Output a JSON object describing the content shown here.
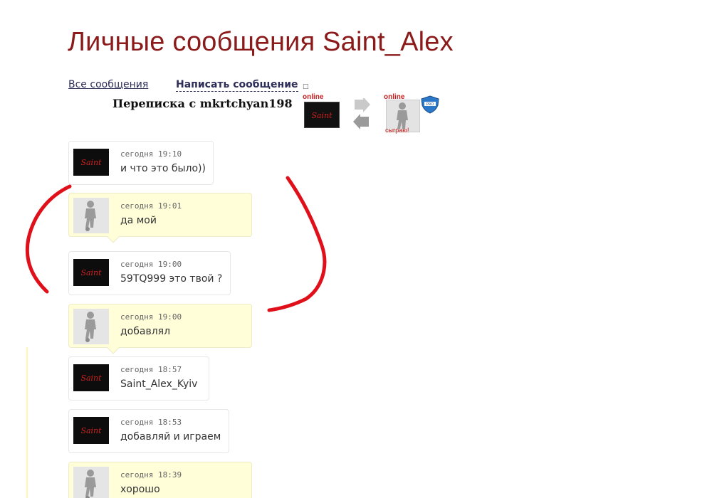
{
  "page": {
    "title": "Личные сообщения Saint_Alex"
  },
  "nav": {
    "all_messages": "Все сообщения",
    "write_message": "Написать сообщение"
  },
  "conversation": {
    "title": "Переписка с mkrtchyan198",
    "online_label_me": "online",
    "online_label_partner": "online",
    "partner_status": "сыграю!",
    "saint_logo_text": "Saint",
    "badge_text": "PRO"
  },
  "messages": [
    {
      "sender": "saint",
      "time": "сегодня 19:10",
      "text": "и что это было))"
    },
    {
      "sender": "other",
      "time": "сегодня 19:01",
      "text": "да мой"
    },
    {
      "sender": "saint",
      "time": "сегодня 19:00",
      "text": "59TQ999 это твой ?"
    },
    {
      "sender": "other",
      "time": "сегодня 19:00",
      "text": "добавлял"
    },
    {
      "sender": "saint",
      "time": "сегодня 18:57",
      "text": "Saint_Alex_Kyiv"
    },
    {
      "sender": "saint",
      "time": "сегодня 18:53",
      "text": "добавляй и играем"
    },
    {
      "sender": "other",
      "time": "сегодня 18:39",
      "text": "хорошо"
    }
  ],
  "colors": {
    "title": "#8b1b1b",
    "other_bubble": "#fffed9",
    "online": "#c62020",
    "annotation": "#e0101a"
  }
}
